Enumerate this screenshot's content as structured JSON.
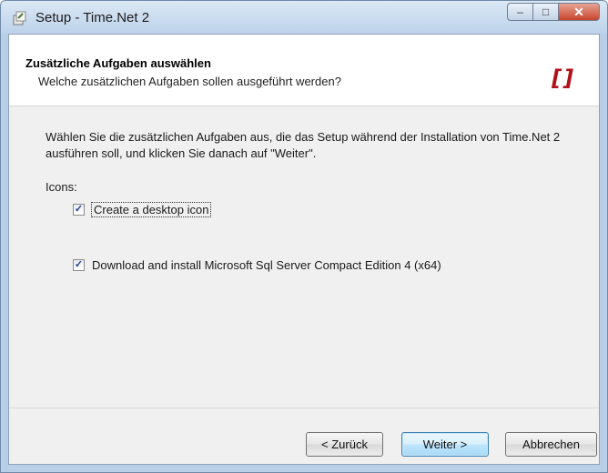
{
  "window": {
    "title": "Setup - Time.Net 2",
    "controls": {
      "minimize": "–",
      "maximize": "□",
      "close": "✕"
    }
  },
  "header": {
    "title": "Zusätzliche Aufgaben auswählen",
    "subtitle": "Welche zusätzlichen Aufgaben sollen ausgeführt werden?",
    "brand_mark": "[]"
  },
  "content": {
    "description": "Wählen Sie die zusätzlichen Aufgaben aus, die das Setup während der Installation von Time.Net 2 ausführen soll, und klicken Sie danach auf \"Weiter\".",
    "group_label": "Icons:",
    "tasks": [
      {
        "label": "Create a desktop icon",
        "checked": true
      },
      {
        "label": "Download and install Microsoft Sql Server Compact Edition 4 (x64)",
        "checked": true
      }
    ]
  },
  "buttons": {
    "back": "< Zurück",
    "next": "Weiter >",
    "cancel": "Abbrechen"
  },
  "icons": {
    "app": "setup-icon",
    "checkmark": "✓"
  },
  "colors": {
    "brand": "#b3111a",
    "close_button": "#c8452d"
  }
}
